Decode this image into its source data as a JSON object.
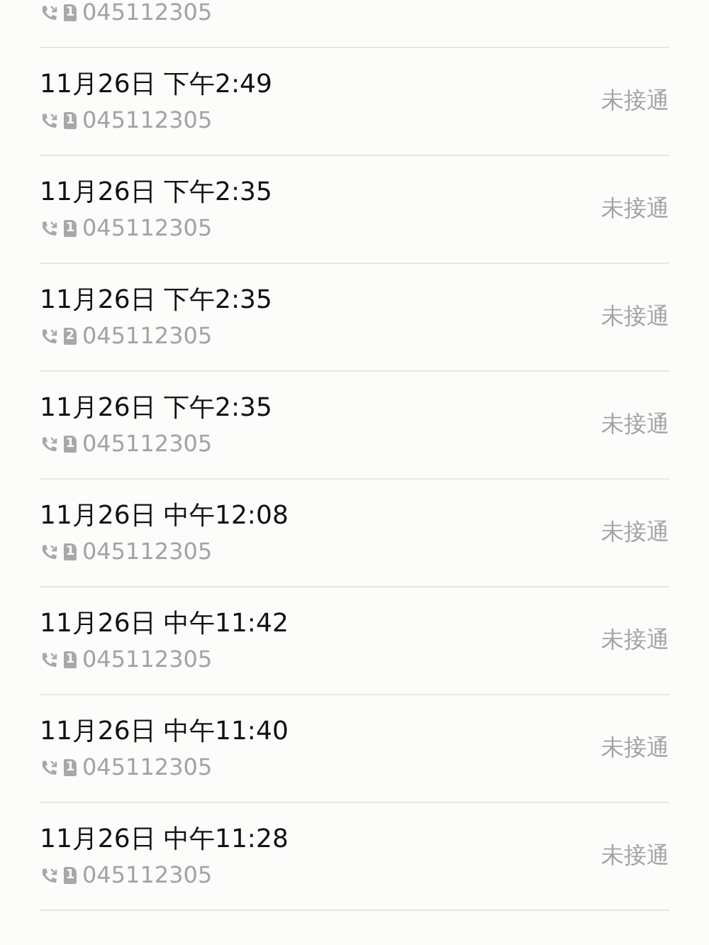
{
  "calls": [
    {
      "sim": "1",
      "number": "045112305"
    },
    {
      "date": "11月26日 下午2:49",
      "sim": "1",
      "number": "045112305",
      "status": "未接通"
    },
    {
      "date": "11月26日 下午2:35",
      "sim": "1",
      "number": "045112305",
      "status": "未接通"
    },
    {
      "date": "11月26日 下午2:35",
      "sim": "2",
      "number": "045112305",
      "status": "未接通"
    },
    {
      "date": "11月26日 下午2:35",
      "sim": "1",
      "number": "045112305",
      "status": "未接通"
    },
    {
      "date": "11月26日 中午12:08",
      "sim": "1",
      "number": "045112305",
      "status": "未接通"
    },
    {
      "date": "11月26日 中午11:42",
      "sim": "1",
      "number": "045112305",
      "status": "未接通"
    },
    {
      "date": "11月26日 中午11:40",
      "sim": "1",
      "number": "045112305",
      "status": "未接通"
    },
    {
      "date": "11月26日 中午11:28",
      "sim": "1",
      "number": "045112305",
      "status": "未接通"
    }
  ]
}
